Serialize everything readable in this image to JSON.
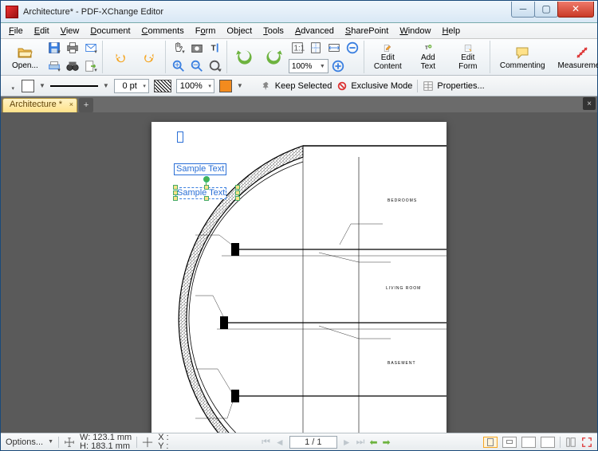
{
  "window": {
    "title": "Architecture* - PDF-XChange Editor"
  },
  "menu": {
    "file": "File",
    "edit": "Edit",
    "view": "View",
    "document": "Document",
    "comments": "Comments",
    "form": "Form",
    "object": "Object",
    "tools": "Tools",
    "advanced": "Advanced",
    "sharepoint": "SharePoint",
    "window": "Window",
    "help": "Help"
  },
  "ribbon": {
    "open": "Open...",
    "zoom_value": "100%",
    "edit_content": "Edit\nContent",
    "add_text": "Add\nText",
    "edit_form": "Edit\nForm",
    "commenting": "Commenting",
    "measurement": "Measurement"
  },
  "propbar": {
    "pt_value": "0 pt",
    "opacity": "100%",
    "keep_selected": "Keep Selected",
    "exclusive": "Exclusive Mode",
    "properties": "Properties..."
  },
  "tabs": {
    "doc": "Architecture *"
  },
  "document": {
    "sample1": "Sample Text",
    "sample2": "Sample Text",
    "rooms": {
      "bedrooms": "BEDROOMS",
      "living": "LIVING ROOM",
      "basement": "BASEMENT"
    }
  },
  "status": {
    "options": "Options...",
    "w": "W: 123.1 mm",
    "h": "H: 183.1 mm",
    "x": "X :",
    "y": "Y :",
    "page": "1 / 1"
  }
}
